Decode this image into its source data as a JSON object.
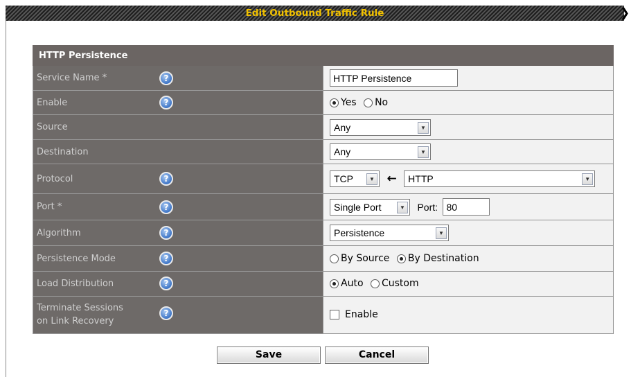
{
  "dialog": {
    "title": "Edit Outbound Traffic Rule",
    "close_glyph": "❯"
  },
  "section": {
    "title": "HTTP Persistence"
  },
  "help_glyph": "?",
  "rows": {
    "service_name": {
      "label": "Service Name *",
      "value": "HTTP Persistence"
    },
    "enable": {
      "label": "Enable",
      "options": [
        "Yes",
        "No"
      ],
      "selected": "Yes"
    },
    "source": {
      "label": "Source",
      "value": "Any"
    },
    "destination": {
      "label": "Destination",
      "value": "Any"
    },
    "protocol": {
      "label": "Protocol",
      "value": "TCP",
      "arrow": "←",
      "preset": "HTTP"
    },
    "port": {
      "label": "Port *",
      "type": "Single Port",
      "port_label": "Port:",
      "port_value": "80"
    },
    "algorithm": {
      "label": "Algorithm",
      "value": "Persistence"
    },
    "persistence_mode": {
      "label": "Persistence Mode",
      "options": [
        "By Source",
        "By Destination"
      ],
      "selected": "By Destination"
    },
    "load_distribution": {
      "label": "Load Distribution",
      "options": [
        "Auto",
        "Custom"
      ],
      "selected": "Auto"
    },
    "terminate_sessions": {
      "label_line1": "Terminate Sessions",
      "label_line2": "on Link Recovery",
      "checkbox_label": "Enable",
      "checked": false
    }
  },
  "buttons": {
    "save": "Save",
    "cancel": "Cancel"
  }
}
